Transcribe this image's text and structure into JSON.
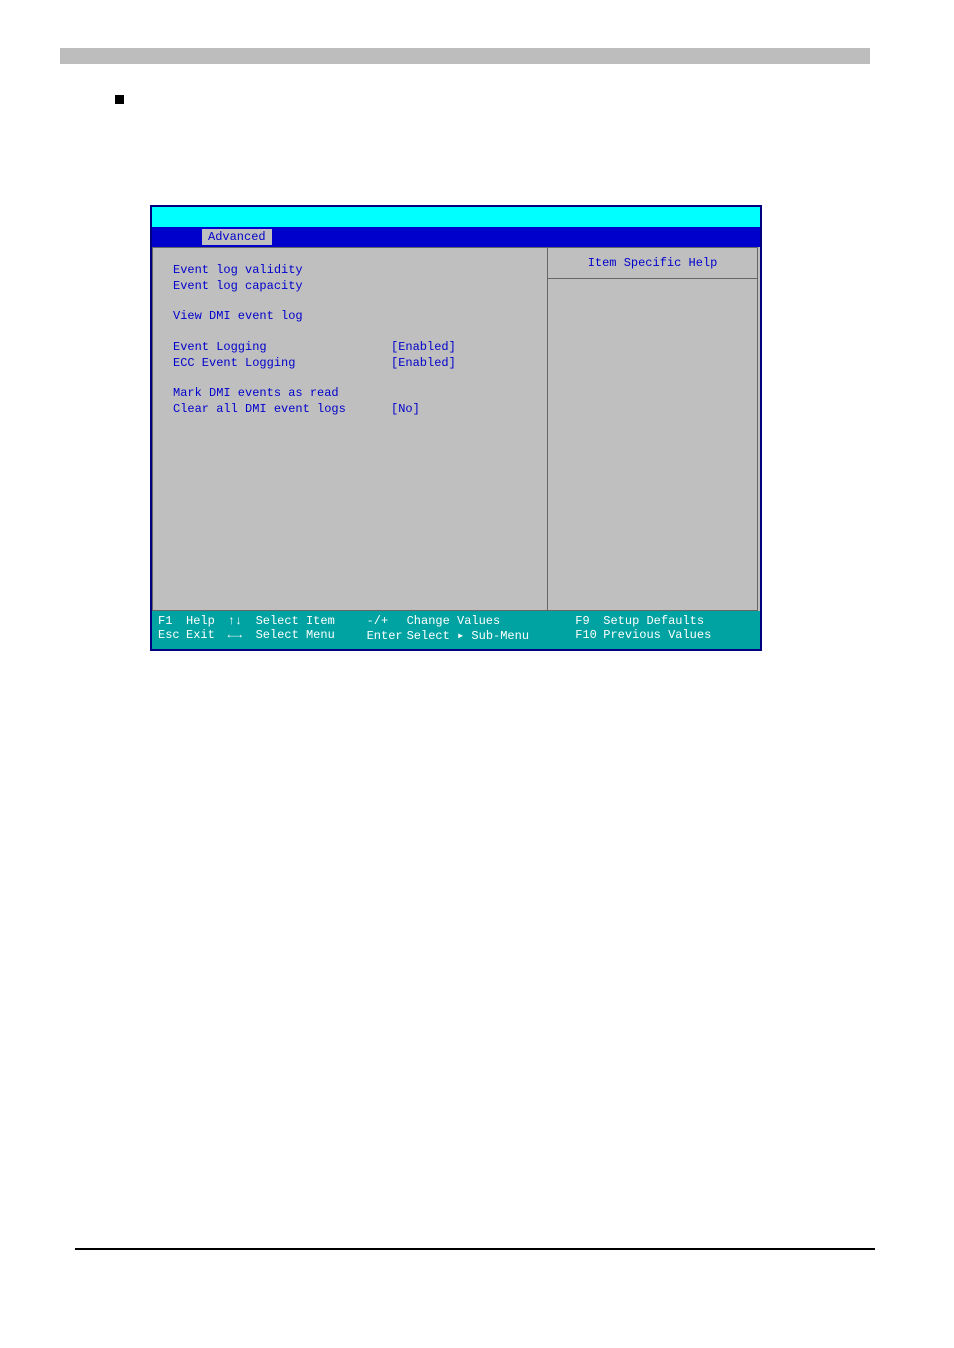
{
  "tabs": {
    "active": "Advanced"
  },
  "left": {
    "validity": {
      "label": "Event log validity",
      "value": ""
    },
    "capacity": {
      "label": "Event log capacity",
      "value": ""
    },
    "view": {
      "label": "View DMI event log",
      "value": ""
    },
    "logging": {
      "label": "Event Logging",
      "value": "[Enabled]"
    },
    "ecc": {
      "label": "ECC Event Logging",
      "value": "[Enabled]"
    },
    "mark": {
      "label": "Mark DMI events as read",
      "value": ""
    },
    "clear": {
      "label": "Clear all DMI event logs",
      "value": "[No]"
    }
  },
  "help": {
    "title": "Item Specific Help"
  },
  "footer": {
    "f1": {
      "key": "F1",
      "lab": "Help"
    },
    "esc": {
      "key": "Esc",
      "lab": "Exit"
    },
    "ud": {
      "key": "↑↓",
      "lab": "Select Item"
    },
    "lr": {
      "key": "←→",
      "lab": "Select Menu"
    },
    "pm": {
      "key": "-/+",
      "lab": "Change Values"
    },
    "enter": {
      "key": "Enter",
      "lab": "Select ▸ Sub-Menu"
    },
    "f9": {
      "key": "F9",
      "lab": "Setup Defaults"
    },
    "f10": {
      "key": "F10",
      "lab": "Previous Values"
    }
  }
}
